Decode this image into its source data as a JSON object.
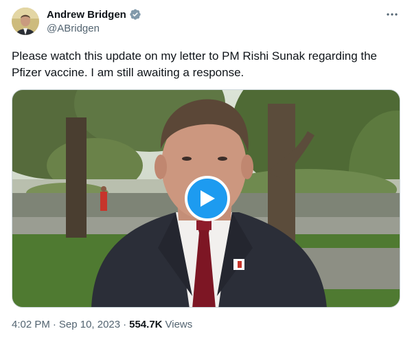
{
  "author": {
    "display_name": "Andrew Bridgen",
    "handle": "@ABridgen",
    "verified_icon": "verified-badge",
    "avatar_icon": "profile-photo"
  },
  "tweet": {
    "text": "Please watch this update on my letter to PM Rishi Sunak regarding the Pfizer vaccine. I am still awaiting a response."
  },
  "media": {
    "type": "video",
    "play_icon": "play-icon"
  },
  "meta": {
    "time": "4:02 PM",
    "separator": "·",
    "date": "Sep 10, 2023",
    "views_count": "554.7K",
    "views_label": "Views"
  },
  "colors": {
    "accent": "#1d9bf0",
    "text_primary": "#0f1419",
    "text_secondary": "#536471"
  }
}
